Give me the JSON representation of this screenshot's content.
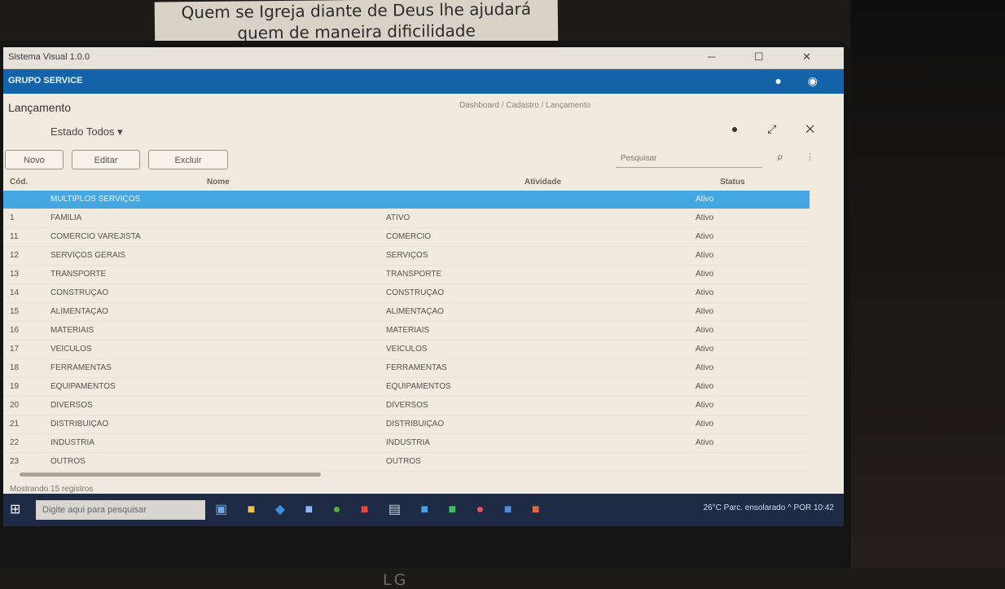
{
  "note": {
    "line1": "Quem se Igreja diante de Deus lhe ajudará",
    "line2": "quem de maneira dificilidade"
  },
  "monitor": {
    "brand": "LG"
  },
  "window": {
    "title": "Sistema Visual 1.0.0",
    "controls": [
      "─",
      "☐",
      "✕"
    ]
  },
  "nav": {
    "brand": "GRUPO SERVICE",
    "icons": [
      "bell-icon",
      "user-icon"
    ]
  },
  "page": {
    "title": "Lançamento",
    "breadcrumb": "Dashboard / Cadastro / Lançamento"
  },
  "filter": {
    "label": "Estado Todos  ▾"
  },
  "buttons": {
    "b1": "Novo",
    "b2": "Editar",
    "b3": "Excluir"
  },
  "search": {
    "placeholder": "Pesquisar"
  },
  "table": {
    "headers": [
      "Cód.",
      "Nome",
      "Atividade",
      "Status"
    ],
    "rows": [
      {
        "c1": "",
        "c2": "MULTIPLOS SERVIÇOS",
        "c3": "",
        "c4": "Ativo"
      },
      {
        "c1": "1",
        "c2": "FAMÍLIA",
        "c3": "ATIVO",
        "c4": "Ativo"
      },
      {
        "c1": "11",
        "c2": "COMÉRCIO VAREJISTA",
        "c3": "COMÉRCIO",
        "c4": "Ativo"
      },
      {
        "c1": "12",
        "c2": "SERVIÇOS GERAIS",
        "c3": "SERVIÇOS",
        "c4": "Ativo"
      },
      {
        "c1": "13",
        "c2": "TRANSPORTE",
        "c3": "TRANSPORTE",
        "c4": "Ativo"
      },
      {
        "c1": "14",
        "c2": "CONSTRUÇÃO",
        "c3": "CONSTRUÇÃO",
        "c4": "Ativo"
      },
      {
        "c1": "15",
        "c2": "ALIMENTAÇÃO",
        "c3": "ALIMENTAÇÃO",
        "c4": "Ativo"
      },
      {
        "c1": "16",
        "c2": "MATERIAIS",
        "c3": "MATERIAIS",
        "c4": "Ativo"
      },
      {
        "c1": "17",
        "c2": "VEÍCULOS",
        "c3": "VEÍCULOS",
        "c4": "Ativo"
      },
      {
        "c1": "18",
        "c2": "FERRAMENTAS",
        "c3": "FERRAMENTAS",
        "c4": "Ativo"
      },
      {
        "c1": "19",
        "c2": "EQUIPAMENTOS",
        "c3": "EQUIPAMENTOS",
        "c4": "Ativo"
      },
      {
        "c1": "20",
        "c2": "DIVERSOS",
        "c3": "DIVERSOS",
        "c4": "Ativo"
      },
      {
        "c1": "21",
        "c2": "DISTRIBUIÇÃO",
        "c3": "DISTRIBUIÇÃO",
        "c4": "Ativo"
      },
      {
        "c1": "22",
        "c2": "INDÚSTRIA",
        "c3": "INDÚSTRIA",
        "c4": "Ativo"
      },
      {
        "c1": "23",
        "c2": "OUTROS",
        "c3": "OUTROS",
        "c4": ""
      }
    ]
  },
  "footer": {
    "text": "Mostrando 15 registros"
  },
  "taskbar": {
    "search_placeholder": "Digite aqui para pesquisar",
    "tray": "26°C  Parc. ensolarado   ^   POR   10:42"
  }
}
